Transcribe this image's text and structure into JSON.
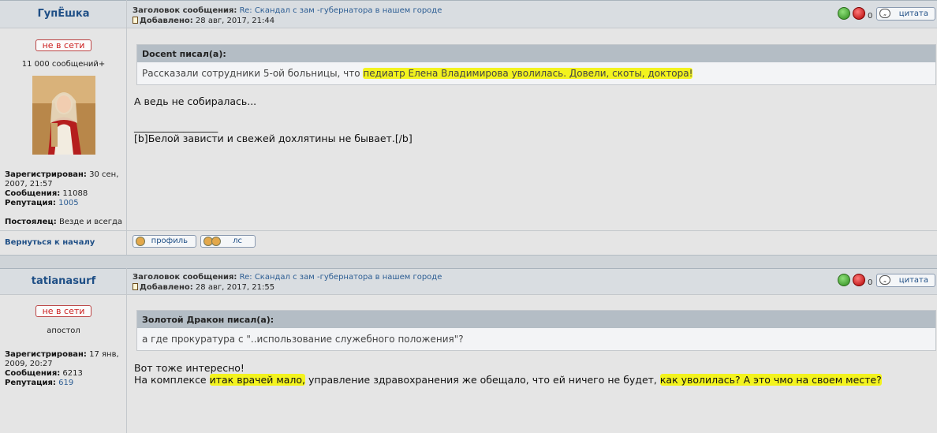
{
  "posts": [
    {
      "nick": "ГупЁшка",
      "subject_label": "Заголовок сообщения:",
      "subject": "Re: Скандал с зам -губернатора в нашем городе",
      "added_label": "Добавлено:",
      "added": "28 авг, 2017, 21:44",
      "vote_count": "0",
      "quote_btn": "цитата",
      "status": "не в сети",
      "rank": "11 000 сообщений+",
      "info": {
        "registered_label": "Зарегистрирован:",
        "registered_1": "30 сен,",
        "registered_2": "2007, 21:57",
        "messages_label": "Сообщения:",
        "messages": "11088",
        "reputation_label": "Репутация:",
        "reputation": "1005",
        "resident_label": "Постоялец:",
        "resident": "Везде и всегда"
      },
      "quote": {
        "author": "Docent писал(а):",
        "text_before": "Рассказали сотрудники 5-ой больницы, что ",
        "text_highlight": "педиатр Елена Владимирова уволилась. Довели, скоты, доктора!"
      },
      "body_line1": "А ведь не собиралась...",
      "signature_line": "_________________",
      "signature": "[b]Белой зависти и свежей дохлятины не бывает.[/b]",
      "back_to_top": "Вернуться к началу",
      "profile_btn": "профиль",
      "pm_btn": "лс"
    },
    {
      "nick": "tatianasurf",
      "subject_label": "Заголовок сообщения:",
      "subject": "Re: Скандал с зам -губернатора в нашем городе",
      "added_label": "Добавлено:",
      "added": "28 авг, 2017, 21:55",
      "vote_count": "0",
      "quote_btn": "цитата",
      "status": "не в сети",
      "rank": "апостол",
      "info": {
        "registered_label": "Зарегистрирован:",
        "registered_1": "17 янв,",
        "registered_2": "2009, 20:27",
        "messages_label": "Сообщения:",
        "messages": "6213",
        "reputation_label": "Репутация:",
        "reputation": "619"
      },
      "quote": {
        "author": "Золотой Дракон писал(а):",
        "text": "а где прокуратура с \"..использование служебного положения\"?"
      },
      "body_line1": "Вот тоже интересно!",
      "body_line2_a": "На комплексе ",
      "body_line2_hl1": "итак врачей мало,",
      "body_line2_b": " управление здравохранения же обещало, что ей ничего не будет, ",
      "body_line2_hl2": "как уволилась? А это чмо на своем месте?"
    }
  ]
}
